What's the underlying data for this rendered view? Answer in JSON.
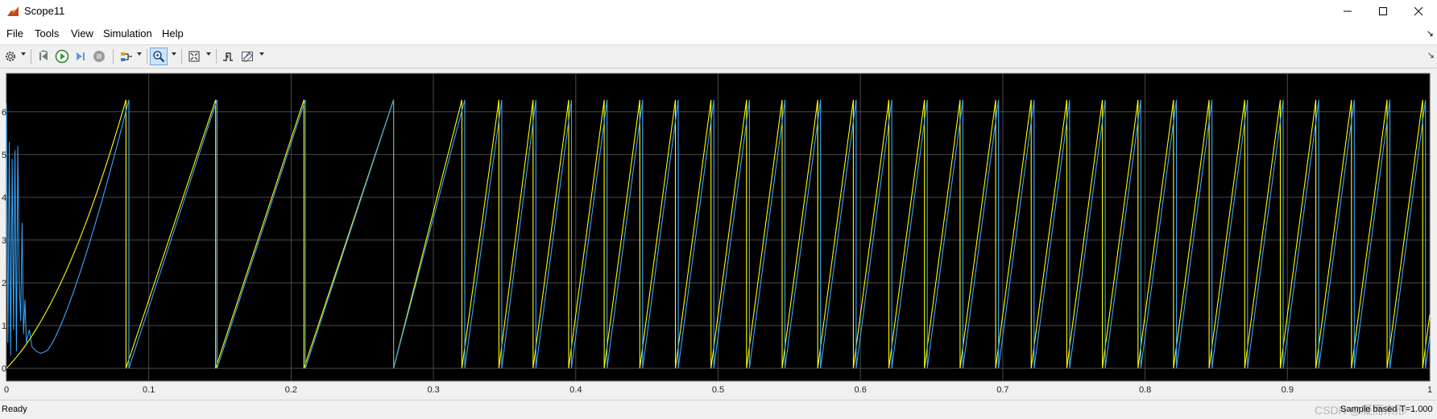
{
  "window": {
    "title": "Scope11",
    "icon": "matlab-scope-icon",
    "controls": [
      "minimize-icon",
      "maximize-icon",
      "close-icon"
    ]
  },
  "menu": {
    "items": [
      "File",
      "Tools",
      "View",
      "Simulation",
      "Help"
    ],
    "collapse_glyph": "↘"
  },
  "toolbar": {
    "icons": [
      "settings-icon",
      "step-back-icon",
      "run-icon",
      "step-forward-icon",
      "stop-icon",
      "highlight-signal-icon",
      "zoom-icon",
      "fit-to-view-icon",
      "triggers-icon",
      "measurements-icon"
    ],
    "active": "zoom-icon",
    "collapse_glyph": "↘"
  },
  "status": {
    "left": "Ready",
    "right": "Sample based",
    "time": "T=1.000",
    "watermark": "CSDN @凝而未形"
  },
  "colors": {
    "plot_background": "#000000",
    "grid": "#4a4a4a",
    "series_yellow": "#ffff00",
    "series_blue": "#3aa7ff"
  },
  "chart_data": {
    "type": "line",
    "xlim": [
      0,
      1
    ],
    "ylim": [
      -0.3,
      6.9
    ],
    "x_ticks": [
      0,
      0.1,
      0.2,
      0.3,
      0.4,
      0.5,
      0.6,
      0.7,
      0.8,
      0.9,
      1
    ],
    "x_tick_labels": [
      "0",
      "0.1",
      "0.2",
      "0.3",
      "0.4",
      "0.5",
      "0.6",
      "0.7",
      "0.8",
      "0.9",
      "1"
    ],
    "y_ticks": [
      0,
      1,
      2,
      3,
      4,
      5,
      6
    ],
    "y_tick_labels": [
      "0",
      "1",
      "2",
      "3",
      "4",
      "5",
      "6"
    ],
    "grid": true,
    "legend": "none",
    "series": [
      {
        "color": "#ffff00",
        "description": "sawtooth 0 to 6.28 with wraps",
        "wrap_times": [
          0.084,
          0.147,
          0.209,
          0.272,
          0.32,
          0.346,
          0.37,
          0.395,
          0.42,
          0.445,
          0.47,
          0.495,
          0.52,
          0.545,
          0.57,
          0.595,
          0.62,
          0.645,
          0.67,
          0.695,
          0.72,
          0.745,
          0.77,
          0.795,
          0.82,
          0.845,
          0.87,
          0.895,
          0.92,
          0.945,
          0.97,
          0.995
        ]
      },
      {
        "color": "#3aa7ff",
        "description": "sawtooth 0 to 6.28 with wraps, slight lag",
        "wrap_times": [
          0.086,
          0.148,
          0.21,
          0.272,
          0.322,
          0.348,
          0.372,
          0.397,
          0.422,
          0.447,
          0.472,
          0.497,
          0.522,
          0.547,
          0.572,
          0.597,
          0.622,
          0.647,
          0.672,
          0.697,
          0.722,
          0.747,
          0.772,
          0.797,
          0.822,
          0.847,
          0.872,
          0.897,
          0.922,
          0.947,
          0.972,
          0.997
        ],
        "startup_transient_max": 5.2
      }
    ],
    "wrap_value": 6.28
  }
}
